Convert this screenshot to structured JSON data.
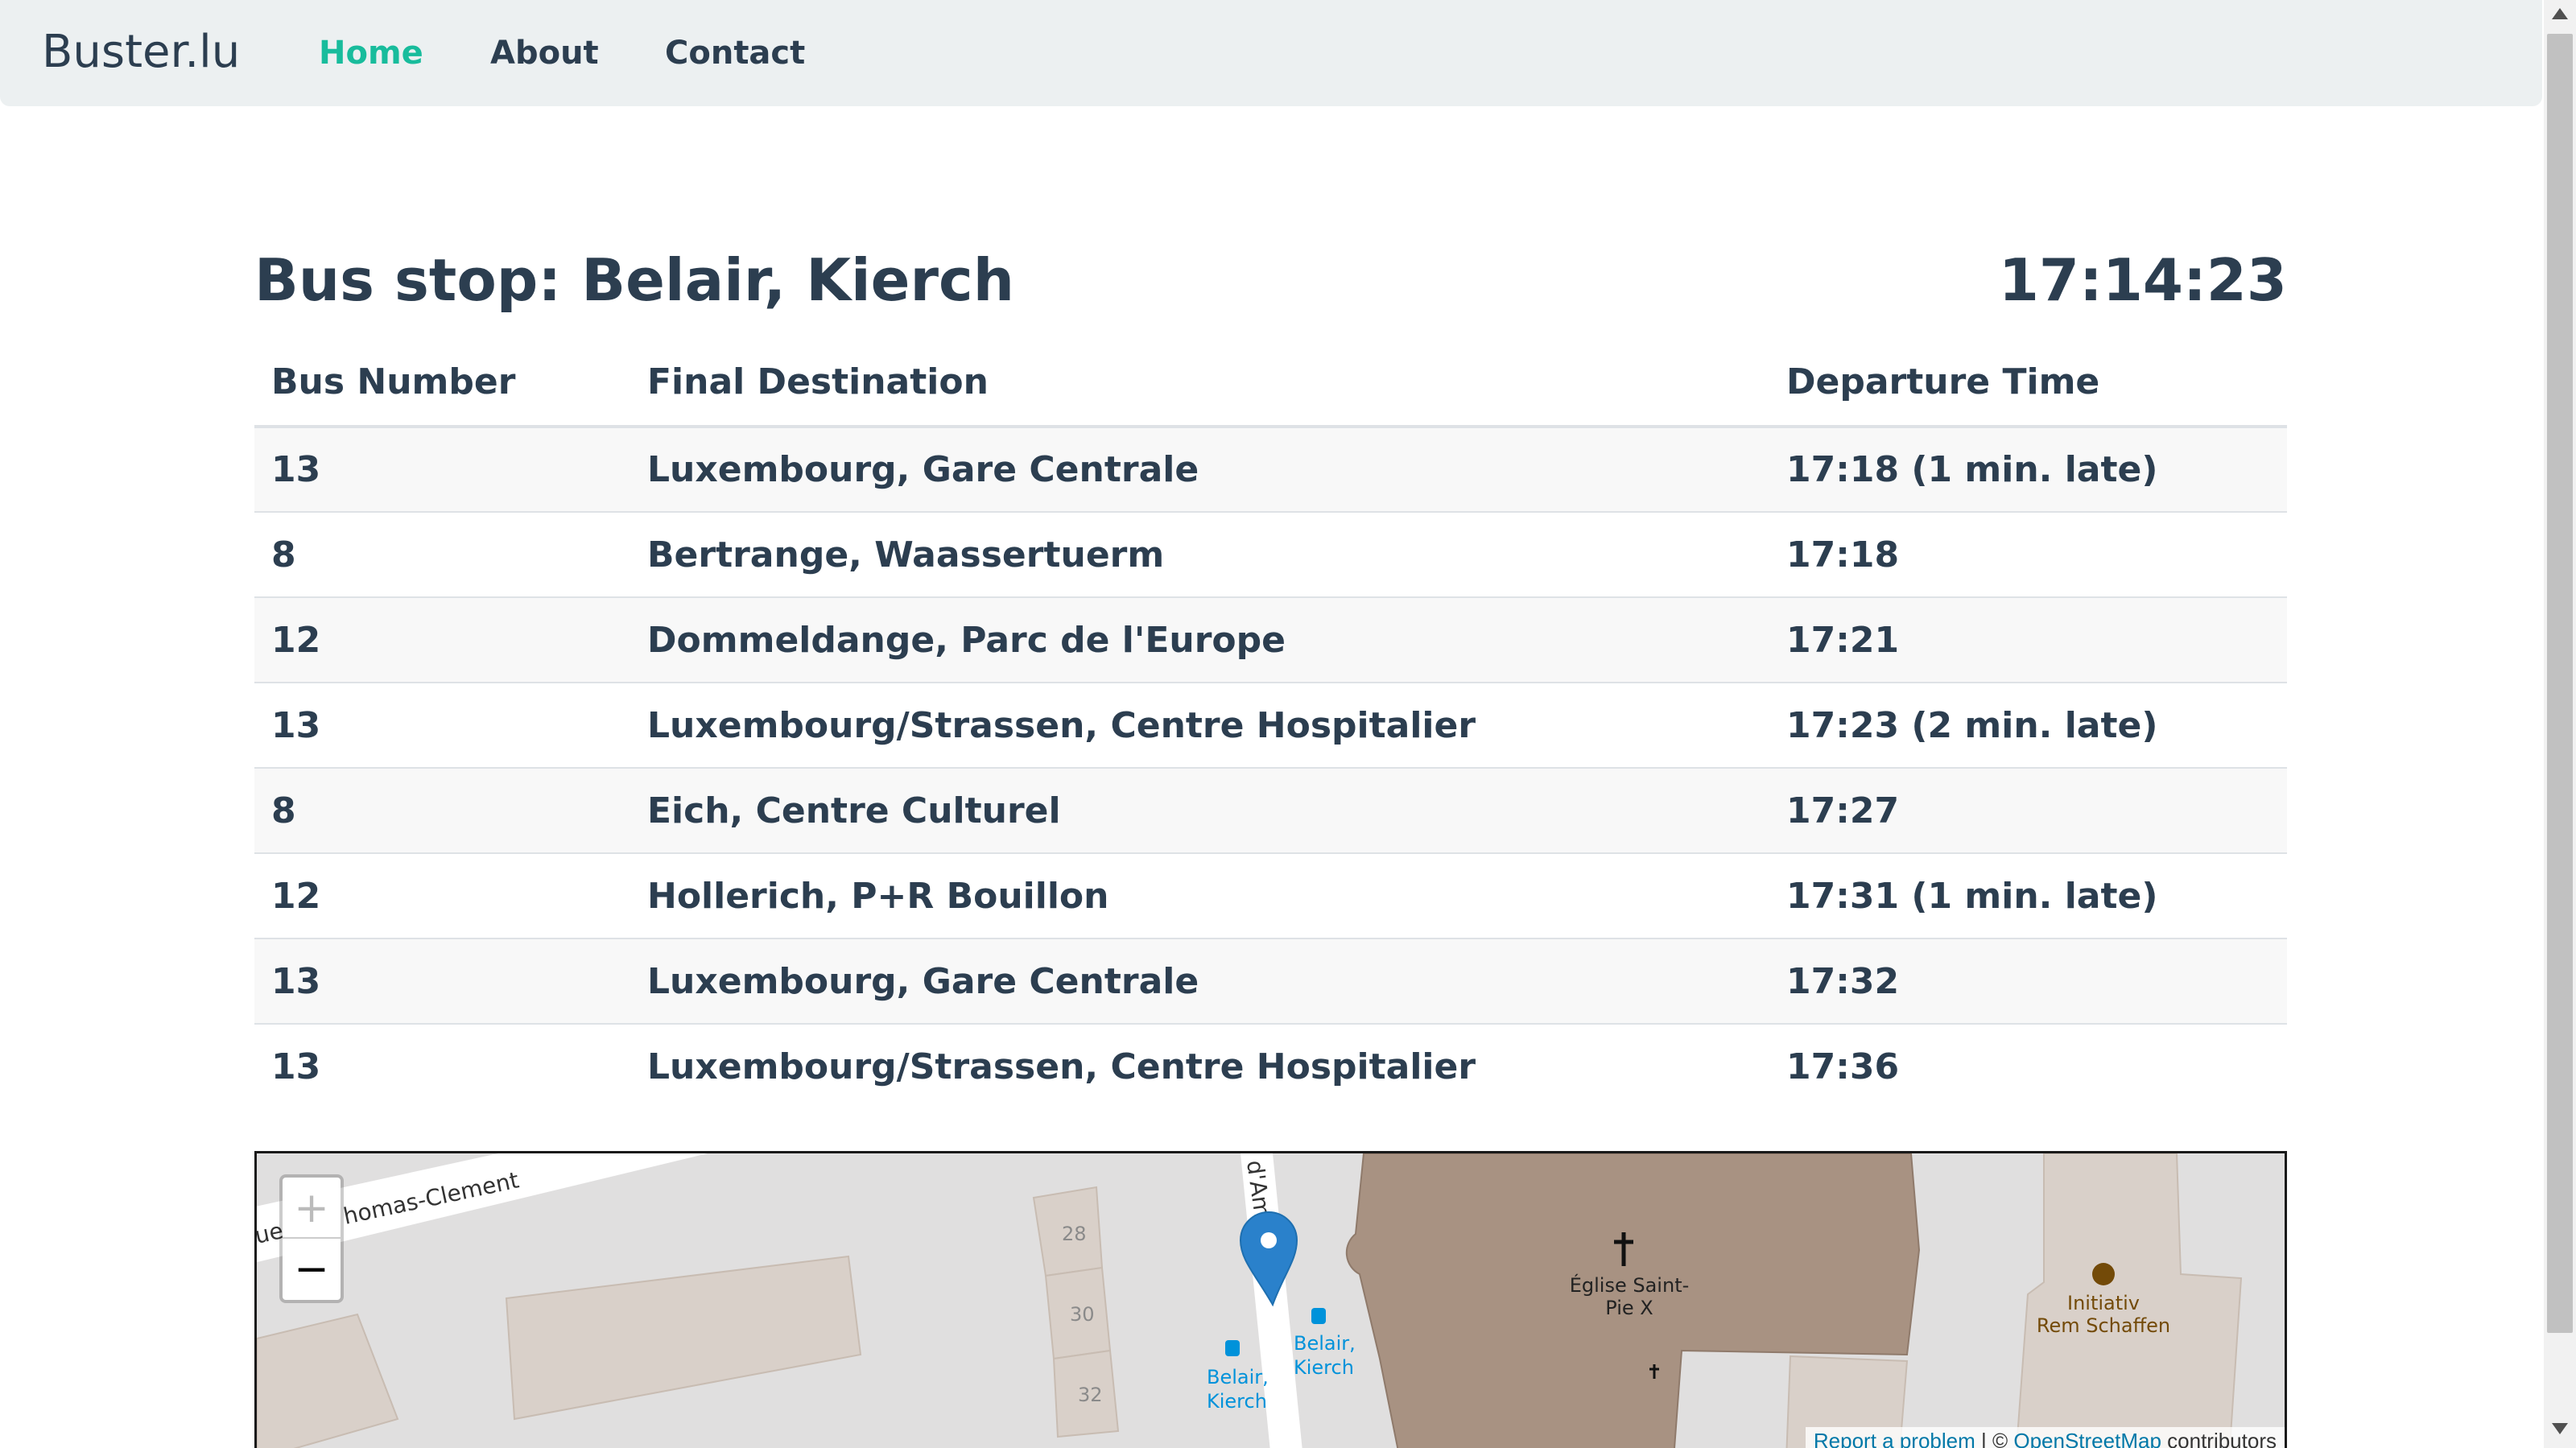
{
  "nav": {
    "brand": "Buster.lu",
    "links": [
      {
        "label": "Home",
        "active": true
      },
      {
        "label": "About",
        "active": false
      },
      {
        "label": "Contact",
        "active": false
      }
    ],
    "accent_color": "#18bc9c"
  },
  "stop": {
    "title": "Bus stop: Belair, Kierch",
    "clock": "17:14:23"
  },
  "table": {
    "headers": [
      "Bus Number",
      "Final Destination",
      "Departure Time"
    ],
    "rows": [
      {
        "bus": "13",
        "destination": "Luxembourg, Gare Centrale",
        "departure": "17:18 (1 min. late)"
      },
      {
        "bus": "8",
        "destination": "Bertrange, Waassertuerm",
        "departure": "17:18"
      },
      {
        "bus": "12",
        "destination": "Dommeldange, Parc de l'Europe",
        "departure": "17:21"
      },
      {
        "bus": "13",
        "destination": "Luxembourg/Strassen, Centre Hospitalier",
        "departure": "17:23 (2 min. late)"
      },
      {
        "bus": "8",
        "destination": "Eich, Centre Culturel",
        "departure": "17:27"
      },
      {
        "bus": "12",
        "destination": "Hollerich, P+R Bouillon",
        "departure": "17:31 (1 min. late)"
      },
      {
        "bus": "13",
        "destination": "Luxembourg, Gare Centrale",
        "departure": "17:32"
      },
      {
        "bus": "13",
        "destination": "Luxembourg/Strassen, Centre Hospitalier",
        "departure": "17:36"
      }
    ]
  },
  "map": {
    "street_label_1": "homas-Clement",
    "street_label_2": "d'Ams",
    "street_label_3": "ue",
    "house_numbers": [
      "28",
      "30",
      "32"
    ],
    "bus_stop_label_1": "Belair,",
    "bus_stop_label_1b": "Kierch",
    "bus_stop_label_2": "Belair,",
    "bus_stop_label_2b": "Kierch",
    "church_label_1": "Église Saint-",
    "church_label_2": "Pie X",
    "poi_label_1": "Initiativ",
    "poi_label_2": "Rem Schaffen",
    "zoom_in": "+",
    "zoom_out": "−",
    "attribution_report": "Report a problem",
    "attribution_sep": " | © ",
    "attribution_osm": "OpenStreetMap",
    "attribution_tail": " contributors"
  }
}
